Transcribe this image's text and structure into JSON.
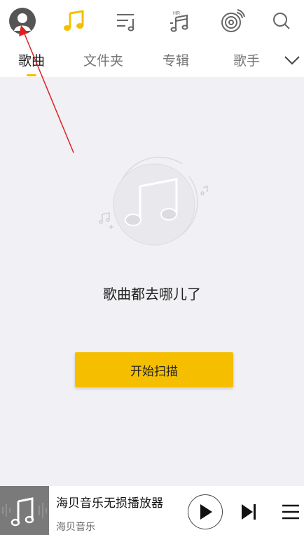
{
  "colors": {
    "accent": "#f5bf00",
    "background": "#f1f0f4",
    "annotation": "#e02020"
  },
  "topbar": {
    "icons": [
      "avatar-icon",
      "music-note-icon",
      "playlist-icon",
      "hr-music-icon",
      "vinyl-radio-icon",
      "search-icon"
    ],
    "hr_badge": "HR"
  },
  "tabs": {
    "items": [
      {
        "label": "歌曲",
        "active": true
      },
      {
        "label": "文件夹",
        "active": false
      },
      {
        "label": "专辑",
        "active": false
      },
      {
        "label": "歌手",
        "active": false
      }
    ]
  },
  "empty_state": {
    "message": "歌曲都去哪儿了",
    "button_label": "开始扫描"
  },
  "player": {
    "title": "海贝音乐无损播放器",
    "artist": "海贝音乐"
  }
}
